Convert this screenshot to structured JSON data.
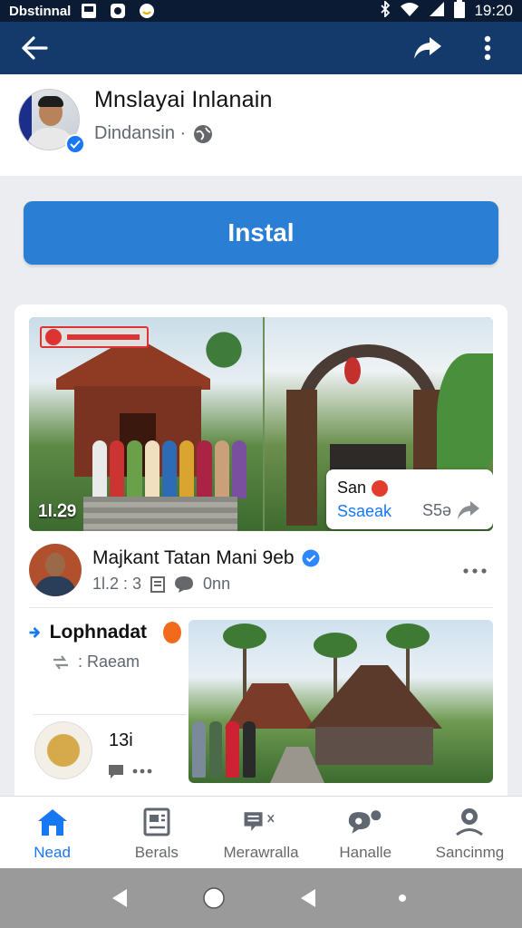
{
  "status_bar": {
    "carrier": "Dbstinnal",
    "time": "19:20"
  },
  "app_bar": {
    "back_icon": "arrow-left-icon",
    "share_icon": "share-arrow-icon",
    "more_icon": "more-vertical-icon"
  },
  "profile": {
    "name": "Mnslayai Inlanain",
    "subtitle": "Dindansin ·"
  },
  "install_label": "Instal",
  "hero": {
    "photo_count": "1l.ᒿ9",
    "share_chip": {
      "line1": "San",
      "line2": "Ssaeak",
      "line3": "S5ə"
    }
  },
  "post": {
    "author": "Majkant Tatan Mani 9eb",
    "meta_left": "1l.2 : 3",
    "meta_right": "0nn"
  },
  "mini_1": {
    "title": "Lophnadat",
    "sub": ": Raeam"
  },
  "mini_2": {
    "number": "13i"
  },
  "bottom_nav": {
    "items": [
      {
        "label": "Nead",
        "icon": "home-icon",
        "active": true
      },
      {
        "label": "Berals",
        "icon": "page-icon",
        "active": false
      },
      {
        "label": "Merawralla",
        "icon": "chat-menu-icon",
        "active": false
      },
      {
        "label": "Hanalle",
        "icon": "chat-bubble-icon",
        "active": false
      },
      {
        "label": "Sancinmg",
        "icon": "person-icon",
        "active": false
      }
    ]
  },
  "colors": {
    "status_bar": "#0a1b33",
    "app_bar": "#133a6b",
    "accent": "#1877f2",
    "install_button": "#2a7fd4"
  }
}
